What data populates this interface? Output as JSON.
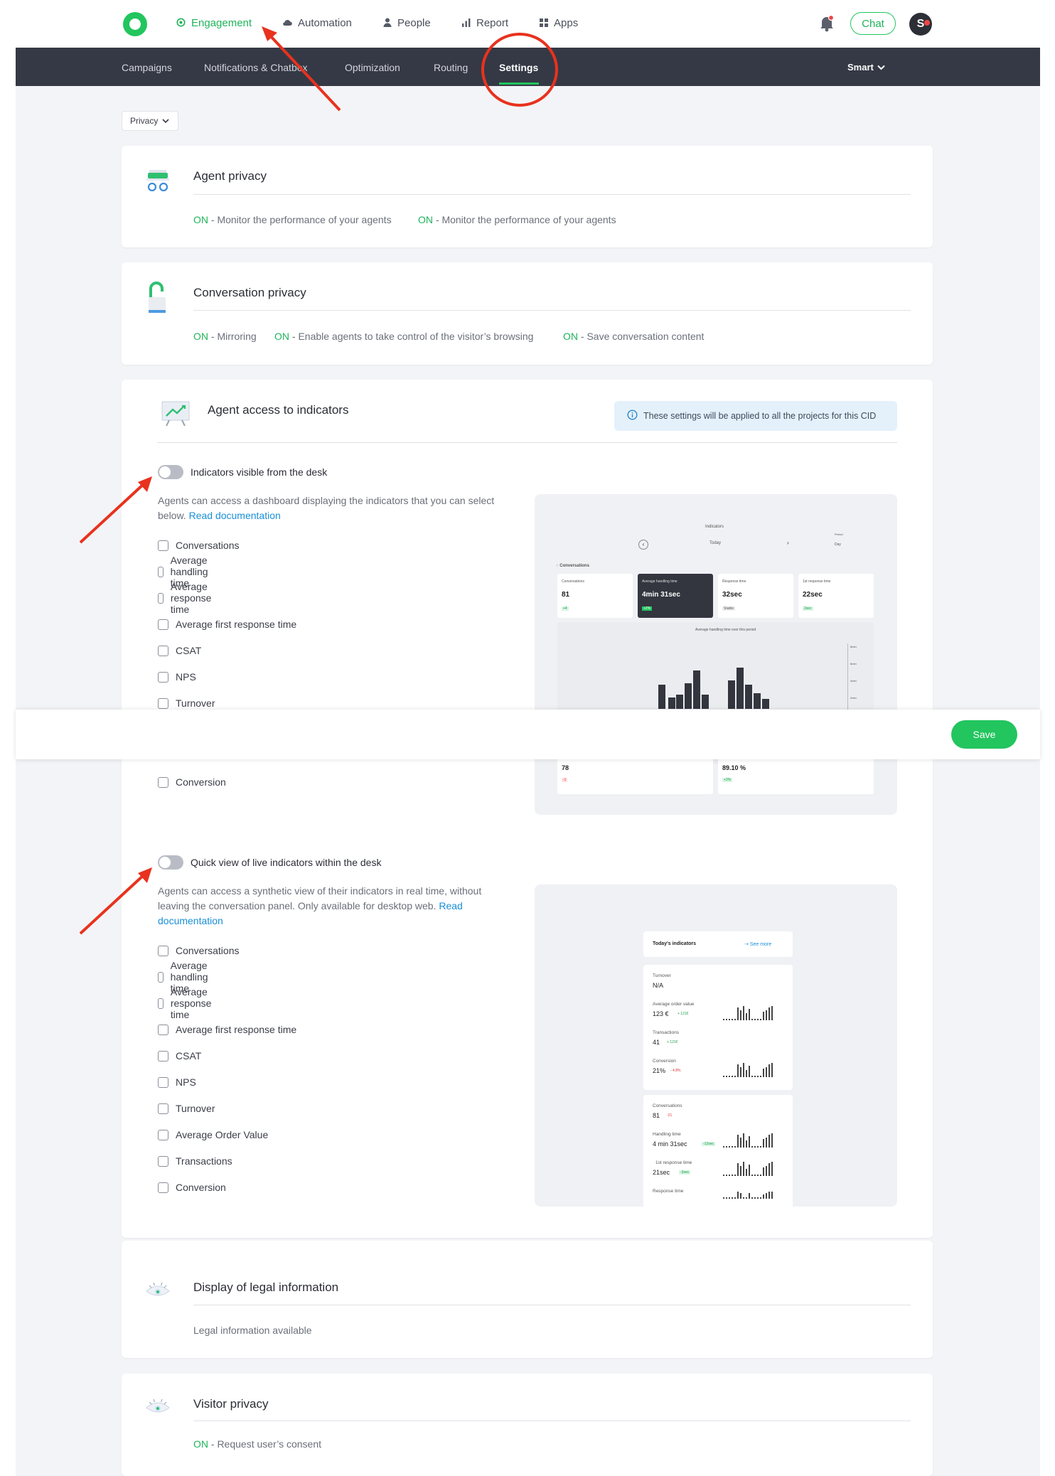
{
  "topnav": {
    "items": [
      {
        "label": "Engagement",
        "icon": "target-icon",
        "active": true
      },
      {
        "label": "Automation",
        "icon": "cloud-icon"
      },
      {
        "label": "People",
        "icon": "person-icon"
      },
      {
        "label": "Report",
        "icon": "bar-chart-icon"
      },
      {
        "label": "Apps",
        "icon": "grid-icon"
      }
    ],
    "chat_label": "Chat",
    "avatar_initial": "S"
  },
  "subnav": {
    "items": [
      "Campaigns",
      "Notifications & Chatbox",
      "Optimization",
      "Routing",
      "Settings"
    ],
    "active": "Settings",
    "right_dropdown": "Smart"
  },
  "privacy_dropdown": "Privacy",
  "agent_privacy": {
    "title": "Agent privacy",
    "statuses": [
      {
        "state": "ON",
        "text": " - Monitor the performance of your agents"
      },
      {
        "state": "ON",
        "text": " - Monitor the performance of your agents"
      }
    ]
  },
  "conversation_privacy": {
    "title": "Conversation privacy",
    "statuses": [
      {
        "state": "ON",
        "text": " - Mirroring"
      },
      {
        "state": "ON",
        "text": " - Enable agents to take control of the visitor’s browsing"
      },
      {
        "state": "ON",
        "text": " - Save conversation content"
      }
    ]
  },
  "indicators": {
    "title": "Agent access to indicators",
    "info": "These settings will be applied to all the projects for this CID",
    "section1": {
      "toggle_label": "Indicators visible from the desk",
      "desc": "Agents can access a dashboard displaying the indicators that you can select below. ",
      "link": "Read documentation",
      "checkboxes": [
        "Conversations",
        "Average handling time",
        "Average response time",
        "Average first response time",
        "CSAT",
        "NPS",
        "Turnover",
        "Conversion"
      ]
    },
    "section2": {
      "toggle_label": "Quick view of live indicators within the desk",
      "desc": "Agents can access a synthetic view of their indicators in real time, without leaving the conversation panel. Only available for desktop web. ",
      "link": "Read documentation",
      "checkboxes": [
        "Conversations",
        "Average handling time",
        "Average response time",
        "Average first response time",
        "CSAT",
        "NPS",
        "Turnover",
        "Average Order Value",
        "Transactions",
        "Conversion"
      ]
    },
    "preview1": {
      "header": "Indicators",
      "date": "Today",
      "period_label": "Period",
      "period": "Day",
      "section": "Conversations",
      "cards": [
        {
          "label": "Conversations",
          "value": "81",
          "badge": "+4"
        },
        {
          "label": "Average handling time",
          "value": "4min 31sec",
          "badge": "+2%"
        },
        {
          "label": "Response time",
          "value": "32sec",
          "badge": "Stable"
        },
        {
          "label": "1st response time",
          "value": "22sec",
          "badge": "2sec"
        }
      ],
      "chart_title": "Average handling time over this period",
      "chart_ticks": [
        "8min",
        "6min",
        "4min",
        "2min"
      ],
      "bottom_values": [
        {
          "value": "78",
          "badge": "-1"
        },
        {
          "value": "89.10 %",
          "badge": "+3%"
        }
      ]
    },
    "preview2": {
      "title": "Today's indicators",
      "see_more": "See more",
      "group1": [
        {
          "label": "Turnover",
          "value": "N/A",
          "badge": ""
        },
        {
          "label": "Average order value",
          "value": "123 €",
          "badge": "+ 121€"
        },
        {
          "label": "Transactions",
          "value": "41",
          "badge": "+ 121€"
        },
        {
          "label": "Conversion",
          "value": "21%",
          "badge": "- 4.8%"
        }
      ],
      "group2": [
        {
          "label": "Conversations",
          "value": "81",
          "badge": "-21"
        },
        {
          "label": "Handling time",
          "value": "4 min 31sec",
          "badge": "-12sec"
        },
        {
          "label": "1st response time",
          "value": "21sec",
          "badge": "-3sec"
        },
        {
          "label": "Response time",
          "value": "",
          "badge": ""
        }
      ]
    }
  },
  "legal": {
    "title": "Display of legal information",
    "text": "Legal information available"
  },
  "visitor_privacy": {
    "title": "Visitor privacy",
    "statuses": [
      {
        "state": "ON",
        "text": " - Request user’s consent"
      }
    ]
  },
  "save_label": "Save",
  "colors": {
    "accent": "#22c55e",
    "dark_nav": "#353945",
    "annotation": "#e8321e"
  }
}
